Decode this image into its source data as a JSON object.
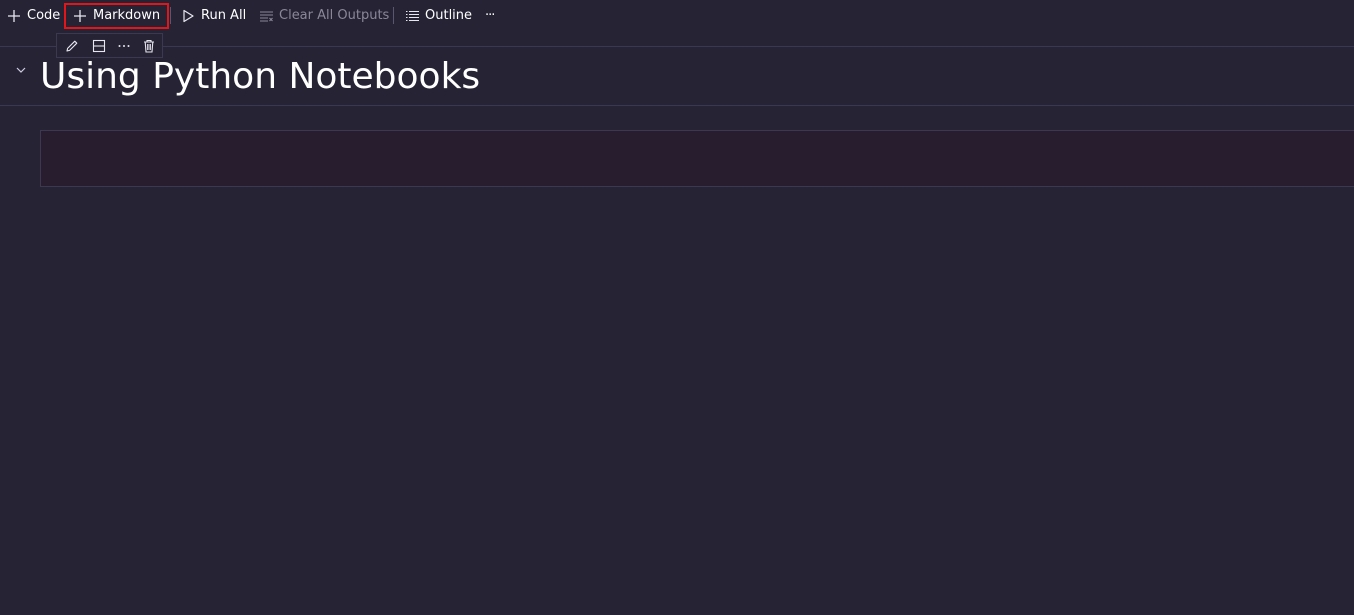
{
  "toolbar": {
    "code_label": "Code",
    "markdown_label": "Markdown",
    "run_all_label": "Run All",
    "clear_outputs_label": "Clear All Outputs",
    "outline_label": "Outline",
    "more_label": "···"
  },
  "cell_toolbar": {
    "icons": [
      "edit-icon",
      "split-cell-icon",
      "more-icon",
      "delete-icon"
    ]
  },
  "notebook": {
    "heading": "Using Python Notebooks",
    "empty_cell_content": ""
  },
  "colors": {
    "background": "#262335",
    "highlight": "#e0161b",
    "text": "#ffffff",
    "disabled_text": "#8a8799",
    "cell_background": "#281c2f"
  }
}
